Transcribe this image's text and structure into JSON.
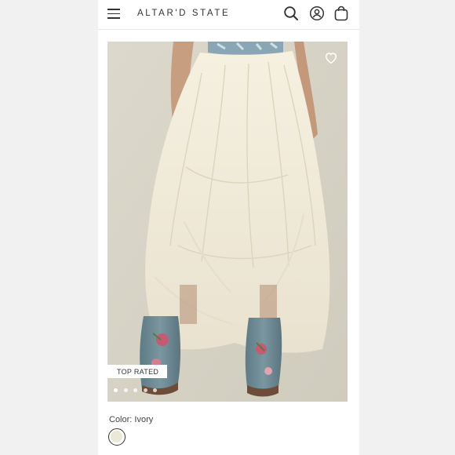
{
  "header": {
    "logo_text": "ALTAR'D STATE",
    "menu_icon": "hamburger-menu-icon",
    "search_icon": "search-icon",
    "account_icon": "account-icon",
    "bag_icon": "shopping-bag-icon"
  },
  "product": {
    "image_alt": "Ivory tiered tulle maxi skirt worn with blue floral cowboy boots",
    "favorite_icon": "heart-icon",
    "badge": "TOP RATED",
    "carousel": {
      "total": 5,
      "active": 0
    },
    "color_label": "Color: Ivory",
    "swatches": [
      {
        "name": "Ivory",
        "color": "#ece7d6",
        "selected": true
      }
    ]
  },
  "colors": {
    "background": "#f1f1f1",
    "panel": "#ffffff",
    "text": "#333333",
    "skirt": "#f3ecdc",
    "boot": "#6f8a93"
  }
}
